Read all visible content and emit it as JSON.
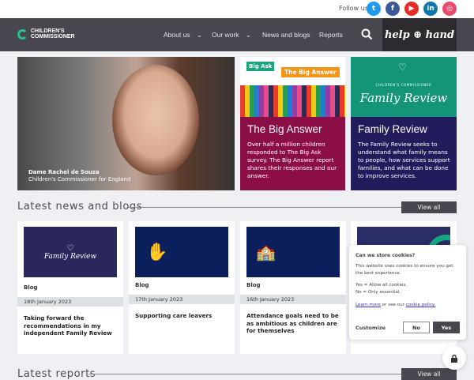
{
  "topbar": {
    "follow_label": "Follow us",
    "social": [
      {
        "name": "twitter",
        "glyph": "t",
        "color": "#1d9bf0"
      },
      {
        "name": "facebook",
        "glyph": "f",
        "color": "#3b5998"
      },
      {
        "name": "youtube",
        "glyph": "▶",
        "color": "#e52d27"
      },
      {
        "name": "linkedin",
        "glyph": "in",
        "color": "#0e76a8"
      },
      {
        "name": "instagram",
        "glyph": "◎",
        "color": "#e94c6a"
      }
    ]
  },
  "nav": {
    "logo_line1": "CHILDREN'S",
    "logo_line2": "COMMISSIONER",
    "items": [
      {
        "label": "About us",
        "dropdown": true
      },
      {
        "label": "Our work",
        "dropdown": true
      },
      {
        "label": "News and blogs"
      },
      {
        "label": "Reports"
      }
    ],
    "help_label": "help ⊕ hand"
  },
  "hero": {
    "name": "Dame Rachel de Souza",
    "role": "Children's Commissioner for England"
  },
  "features": [
    {
      "badge1": "Big Ask",
      "badge2": "The Big Answer",
      "title": "The Big Answer",
      "text": "Over half a million children responded to The Big Ask survey. The Big Answer report shares their responses and our answer.",
      "color": "#8c0e47"
    },
    {
      "eyebrow": "CHILDREN'S COMMISSIONER",
      "logo_text": "Family Review",
      "title": "Family Review",
      "text": "The Family Review seeks to understand what family means to people, how services support families, and what can be done to improve services.",
      "color": "#221c5c",
      "top_color": "#14957a"
    }
  ],
  "news": {
    "heading": "Latest news and blogs",
    "view_all": "View all",
    "cards": [
      {
        "type": "Blog",
        "date": "18th January 2023",
        "title": "Taking forward the recommendations in my independent Family Review",
        "image_text": "Family Review"
      },
      {
        "type": "Blog",
        "date": "17th January 2023",
        "title": "Supporting care leavers"
      },
      {
        "type": "Blog",
        "date": "16th January 2023",
        "title": "Attendance goals need to be as ambitious as children are for themselves"
      }
    ]
  },
  "reports": {
    "heading": "Latest reports",
    "view_all": "View all"
  },
  "cookie": {
    "title": "Can we store cookies?",
    "text": "This website uses cookies to ensure you get the best experience.",
    "yes_line": "Yes = Allow all cookies.",
    "no_line": "No = Only essential.",
    "learn_more": "Learn more",
    "or_text": " or see our ",
    "policy": "cookie policy.",
    "customize": "Customize",
    "no": "No",
    "yes": "Yes"
  }
}
